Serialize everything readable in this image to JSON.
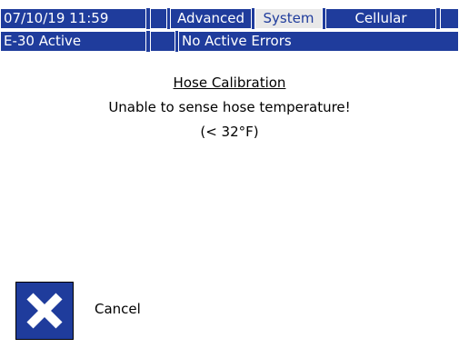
{
  "status_bar": {
    "datetime": "07/10/19 11:59",
    "tabs": [
      {
        "label": "Advanced",
        "selected": false
      },
      {
        "label": "System",
        "selected": true
      },
      {
        "label": "Cellular",
        "selected": false
      }
    ]
  },
  "alert_bar": {
    "mode": "E-30 Active",
    "errors": "No Active Errors"
  },
  "dialog": {
    "title": "Hose Calibration",
    "message": "Unable to sense hose temperature!",
    "detail": "(< 32°F)"
  },
  "actions": {
    "cancel": {
      "label": "Cancel",
      "icon": "x-icon"
    }
  },
  "colors": {
    "accent": "#1f3c9c",
    "selected_tab": "#e8e8e8",
    "background": "#ffffff"
  }
}
